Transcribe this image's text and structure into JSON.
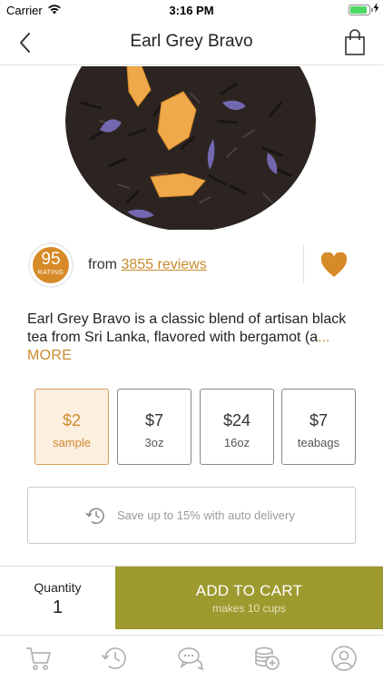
{
  "status_bar": {
    "carrier": "Carrier",
    "time": "3:16 PM",
    "battery_level": 0.9
  },
  "nav": {
    "title": "Earl Grey Bravo"
  },
  "rating": {
    "score": "95",
    "label": "RATING"
  },
  "reviews": {
    "prefix": "from",
    "link": "3855 reviews"
  },
  "description": {
    "text": "Earl Grey Bravo is a classic blend of artisan black tea from Sri Lanka, flavored with bergamot (a",
    "ellipsis": "...",
    "more": "MORE"
  },
  "options": [
    {
      "price": "$2",
      "size": "sample",
      "selected": true
    },
    {
      "price": "$7",
      "size": "3oz",
      "selected": false
    },
    {
      "price": "$24",
      "size": "16oz",
      "selected": false
    },
    {
      "price": "$7",
      "size": "teabags",
      "selected": false
    }
  ],
  "auto_delivery": {
    "text": "Save up to 15% with auto delivery"
  },
  "cart": {
    "quantity_label": "Quantity",
    "quantity_value": "1",
    "add_label": "ADD TO CART",
    "add_sub": "makes 10 cups"
  },
  "colors": {
    "accent": "#d78a28",
    "cart_button": "#9d9a2f",
    "selected_bg": "#fbefe0"
  },
  "tabs": [
    {
      "icon": "cart-icon"
    },
    {
      "icon": "history-icon"
    },
    {
      "icon": "chat-icon"
    },
    {
      "icon": "coins-icon"
    },
    {
      "icon": "profile-icon"
    }
  ]
}
